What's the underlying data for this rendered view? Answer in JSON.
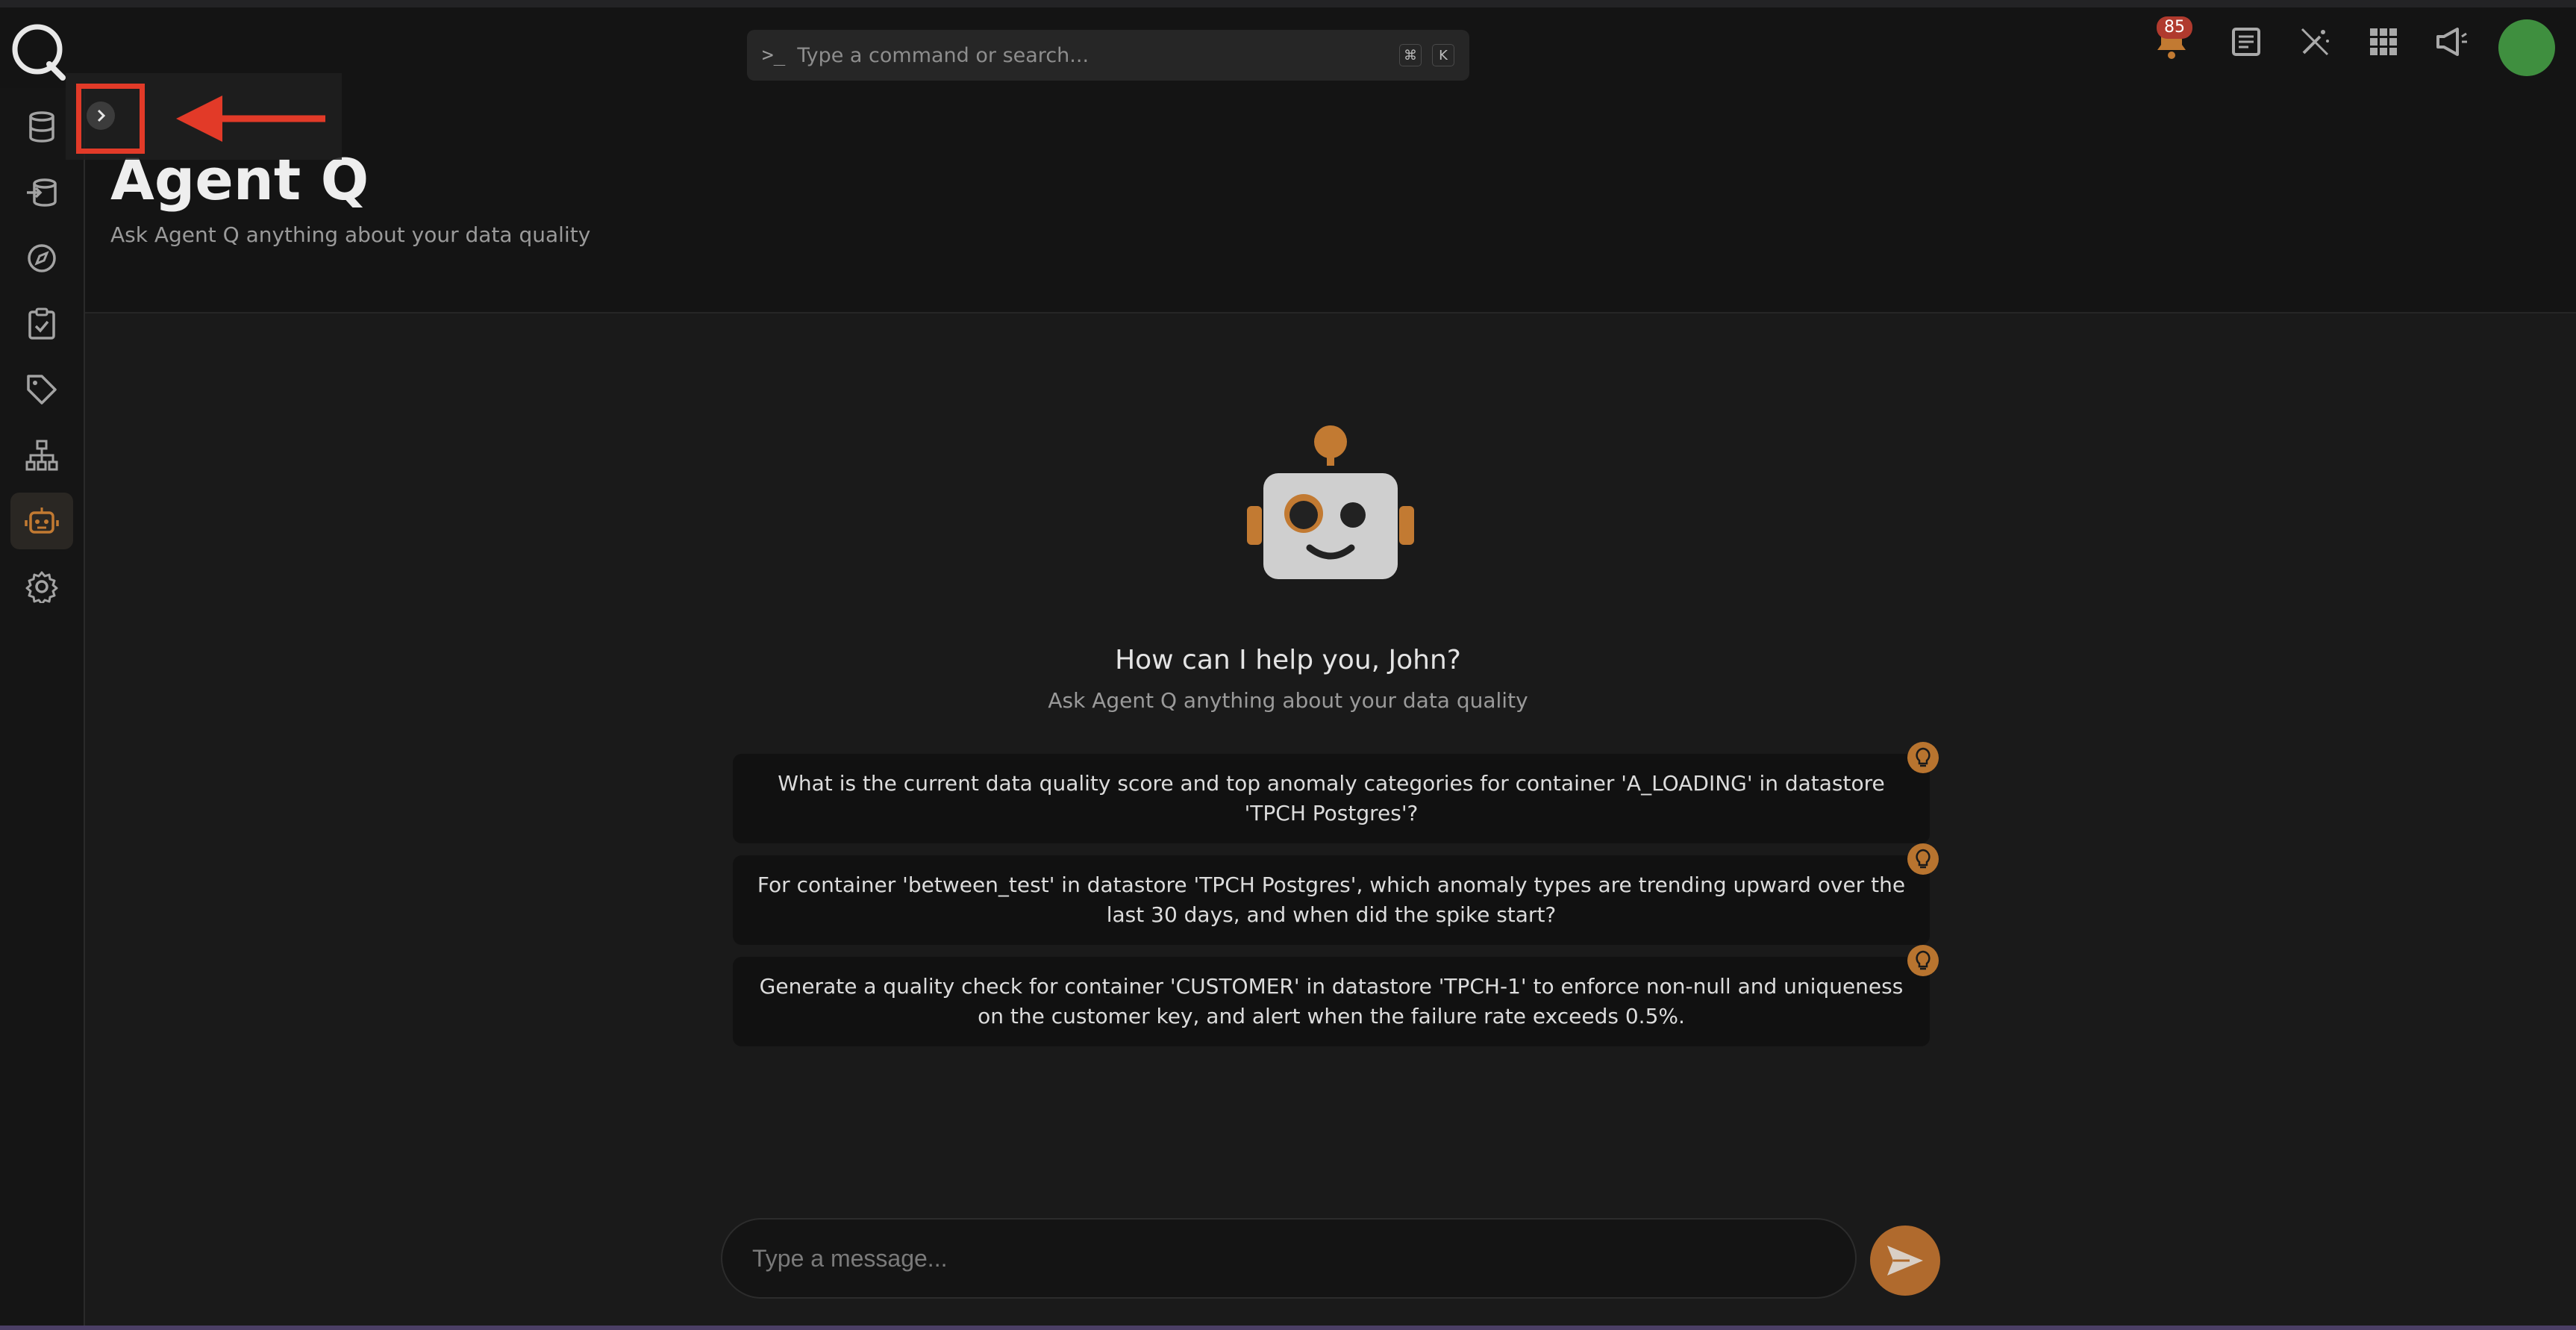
{
  "topbar": {
    "search_placeholder": "Type a command or search...",
    "shortcut_keys": [
      "⌘",
      "K"
    ],
    "notification_count": "85"
  },
  "header": {
    "title": "Agent Q",
    "subtitle": "Ask Agent Q anything about your data quality"
  },
  "sidebar": {
    "items": [
      {
        "icon": "database-icon"
      },
      {
        "icon": "source-datastore-icon"
      },
      {
        "icon": "explore-compass-icon"
      },
      {
        "icon": "checklist-icon"
      },
      {
        "icon": "tag-icon"
      },
      {
        "icon": "hierarchy-icon"
      },
      {
        "icon": "robot-icon",
        "active": true
      },
      {
        "icon": "gear-icon"
      }
    ]
  },
  "main": {
    "greeting": "How can I help you, John?",
    "greeting_sub": "Ask Agent Q anything about your data quality",
    "suggestions": [
      "What is the current data quality score and top anomaly categories for container 'A_LOADING' in datastore 'TPCH Postgres'?",
      "For container 'between_test' in datastore 'TPCH Postgres', which anomaly types are trending upward over the last 30 days, and when did the spike start?",
      "Generate a quality check for container 'CUSTOMER' in datastore 'TPCH-1' to enforce non-null and uniqueness on the customer key, and alert when the failure rate exceeds 0.5%."
    ],
    "message_placeholder": "Type a message..."
  },
  "colors": {
    "accent": "#b06a2d",
    "highlight": "#e23a28",
    "avatar": "#3f8f3f"
  }
}
